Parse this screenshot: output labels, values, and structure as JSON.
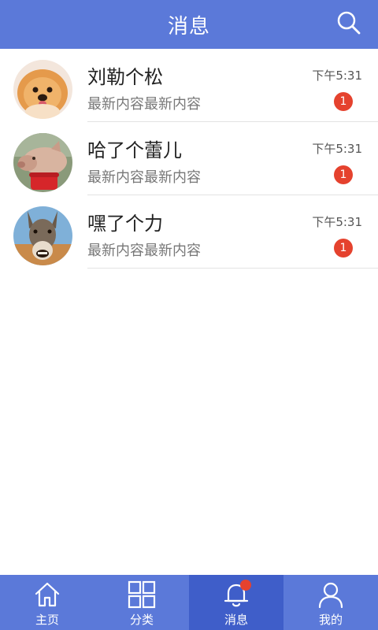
{
  "header": {
    "title": "消息",
    "search_icon": "search-icon"
  },
  "colors": {
    "primary": "#5b79d9",
    "primary_active": "#3f5ec9",
    "badge": "#e5422e"
  },
  "messages": [
    {
      "name": "刘勒个松",
      "preview": "最新内容最新内容",
      "time": "下午5:31",
      "unread": "1",
      "avatar": "pomeranian-dog-avatar"
    },
    {
      "name": "哈了个蕾儿",
      "preview": "最新内容最新内容",
      "time": "下午5:31",
      "unread": "1",
      "avatar": "pig-avatar"
    },
    {
      "name": "嘿了个力",
      "preview": "最新内容最新内容",
      "time": "下午5:31",
      "unread": "1",
      "avatar": "donkey-avatar"
    }
  ],
  "tabbar": {
    "tabs": [
      {
        "label": "主页",
        "icon": "home-icon",
        "active": false
      },
      {
        "label": "分类",
        "icon": "grid-icon",
        "active": false
      },
      {
        "label": "消息",
        "icon": "bell-icon",
        "active": true
      },
      {
        "label": "我的",
        "icon": "user-icon",
        "active": false
      }
    ]
  }
}
